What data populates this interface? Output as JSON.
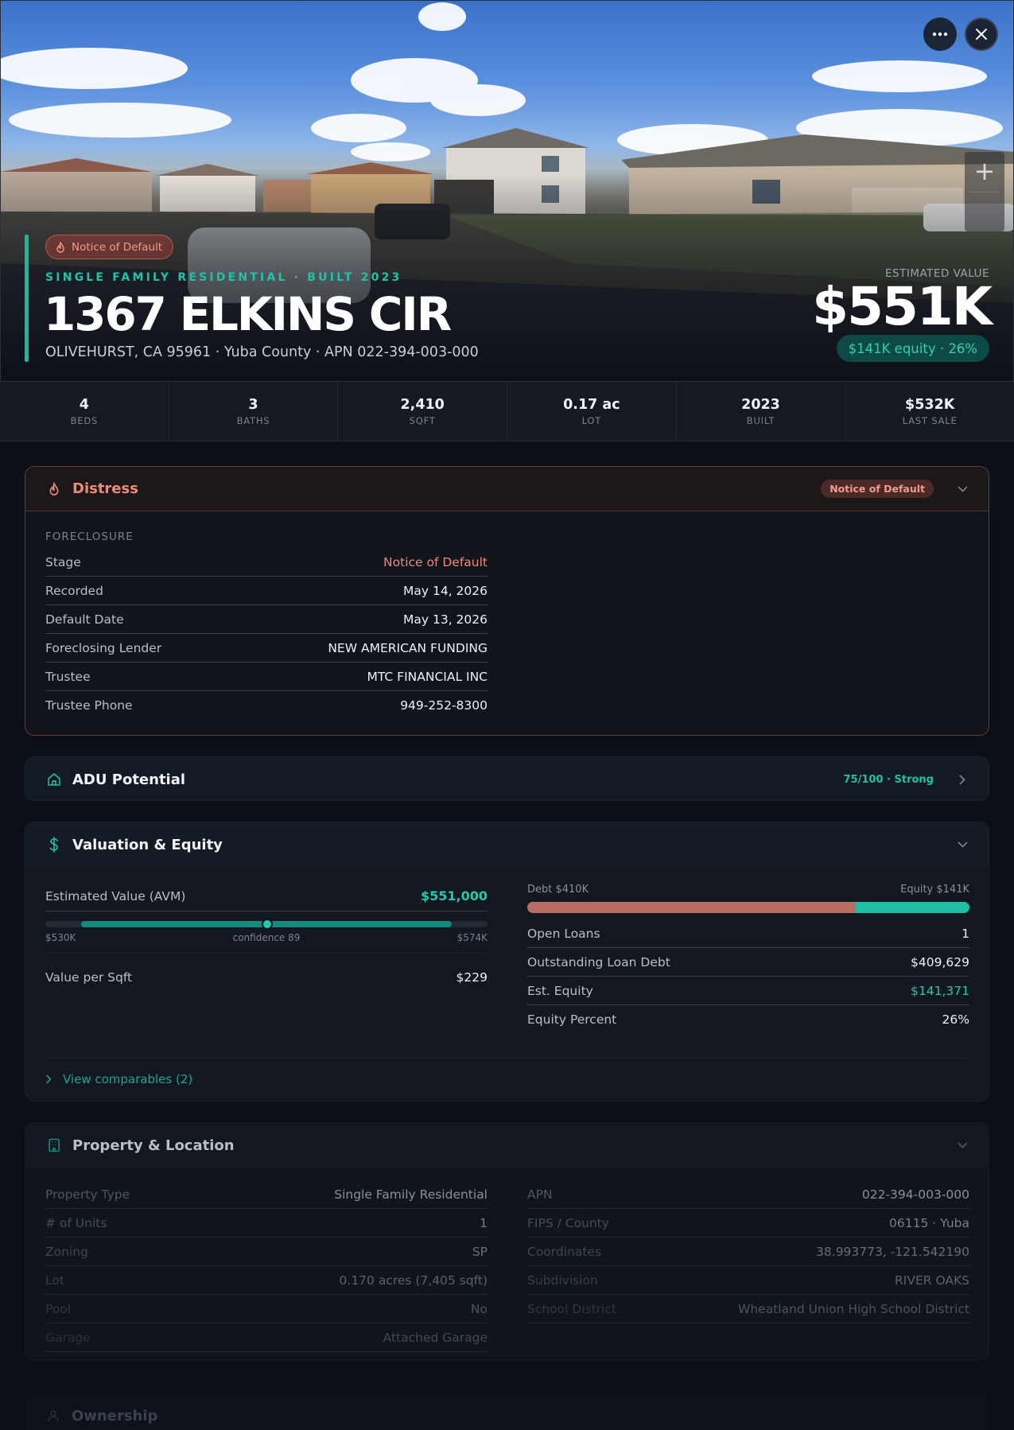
{
  "hero": {
    "badge": "Notice of Default",
    "subtitle": "SINGLE FAMILY RESIDENTIAL · BUILT 2023",
    "address": "1367 ELKINS CIR",
    "location_line": "OLIVEHURST, CA 95961 · Yuba County · APN 022-394-003-000",
    "estimated_value_label": "ESTIMATED VALUE",
    "estimated_value": "$551K",
    "equity_pill": "$141K equity · 26%"
  },
  "stats": [
    {
      "value": "4",
      "label": "BEDS"
    },
    {
      "value": "3",
      "label": "BATHS"
    },
    {
      "value": "2,410",
      "label": "SQFT"
    },
    {
      "value": "0.17 ac",
      "label": "LOT"
    },
    {
      "value": "2023",
      "label": "BUILT"
    },
    {
      "value": "$532K",
      "label": "LAST SALE"
    }
  ],
  "distress": {
    "title": "Distress",
    "badge": "Notice of Default",
    "section_label": "FORECLOSURE",
    "rows": [
      {
        "label": "Stage",
        "value": "Notice of Default"
      },
      {
        "label": "Recorded",
        "value": "May 14, 2026"
      },
      {
        "label": "Default Date",
        "value": "May 13, 2026"
      },
      {
        "label": "Foreclosing Lender",
        "value": "NEW AMERICAN FUNDING"
      },
      {
        "label": "Trustee",
        "value": "MTC FINANCIAL INC"
      },
      {
        "label": "Trustee Phone",
        "value": "949-252-8300"
      }
    ]
  },
  "adu": {
    "title": "ADU Potential",
    "score": "75/100 · Strong"
  },
  "valuation": {
    "title": "Valuation & Equity",
    "avm_label": "Estimated Value (AVM)",
    "avm_value": "$551,000",
    "range_low": "$530K",
    "range_high": "$574K",
    "confidence": "confidence 89",
    "value_per_sqft_label": "Value per Sqft",
    "value_per_sqft": "$229",
    "debt_label": "Debt $410K",
    "equity_label": "Equity $141K",
    "debt_fraction": 0.743,
    "rows": [
      {
        "label": "Open Loans",
        "value": "1"
      },
      {
        "label": "Outstanding Loan Debt",
        "value": "$409,629"
      },
      {
        "label": "Est. Equity",
        "value": "$141,371"
      },
      {
        "label": "Equity Percent",
        "value": "26%"
      }
    ],
    "comparables_link": "View comparables (2)"
  },
  "property": {
    "title": "Property & Location",
    "left_rows": [
      {
        "label": "Property Type",
        "value": "Single Family Residential"
      },
      {
        "label": "# of Units",
        "value": "1"
      },
      {
        "label": "Zoning",
        "value": "SP"
      },
      {
        "label": "Lot",
        "value": "0.170 acres (7,405 sqft)"
      },
      {
        "label": "Pool",
        "value": "No"
      },
      {
        "label": "Garage",
        "value": "Attached Garage"
      }
    ],
    "right_rows": [
      {
        "label": "APN",
        "value": "022-394-003-000"
      },
      {
        "label": "FIPS / County",
        "value": "06115 · Yuba"
      },
      {
        "label": "Coordinates",
        "value": "38.993773, -121.542190"
      },
      {
        "label": "Subdivision",
        "value": "RIVER OAKS"
      },
      {
        "label": "School District",
        "value": "Wheatland Union High School District"
      }
    ]
  },
  "ownership": {
    "title": "Ownership"
  },
  "colors": {
    "accent_teal": "#1fc3a8",
    "distress_red": "#ef8a77",
    "background": "#0c1016"
  },
  "icons": [
    "more-icon",
    "close-icon",
    "zoom-in-icon",
    "flame-icon",
    "home-icon",
    "dollar-icon",
    "building-icon",
    "chevron-down-icon",
    "chevron-right-icon"
  ]
}
